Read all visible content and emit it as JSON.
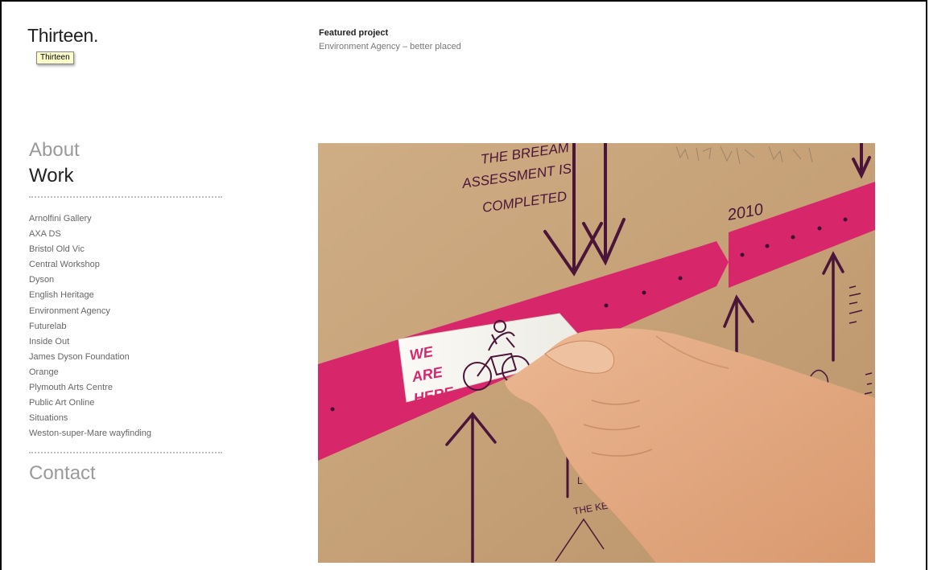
{
  "site": {
    "logo": "Thirteen.",
    "logo_tooltip": "Thirteen"
  },
  "featured": {
    "label": "Featured project",
    "title": "Environment Agency – better placed"
  },
  "nav": {
    "about": "About",
    "work": "Work",
    "contact": "Contact",
    "work_items": [
      "Arnolfini Gallery",
      "AXA DS",
      "Bristol Old Vic",
      "Central Workshop",
      "Dyson",
      "English Heritage",
      "Environment Agency",
      "Futurelab",
      "Inside Out",
      "James Dyson Foundation",
      "Orange",
      "Plymouth Arts Centre",
      "Public Art Online",
      "Situations",
      "Weston-super-Mare wayfinding"
    ]
  },
  "photo": {
    "caption_top": [
      "THE BREEAM",
      "ASSESSMENT IS",
      "COMPLETED"
    ],
    "year": "2010",
    "tag": [
      "WE",
      "ARE",
      "HERE"
    ],
    "corner_text": [
      "L",
      "THE KE"
    ],
    "colors": {
      "cardboard": "#c8a47a",
      "magenta": "#d8266a",
      "ink": "#4a1538",
      "tag_text": "#d8266a",
      "skin": "#e2a97f"
    }
  }
}
